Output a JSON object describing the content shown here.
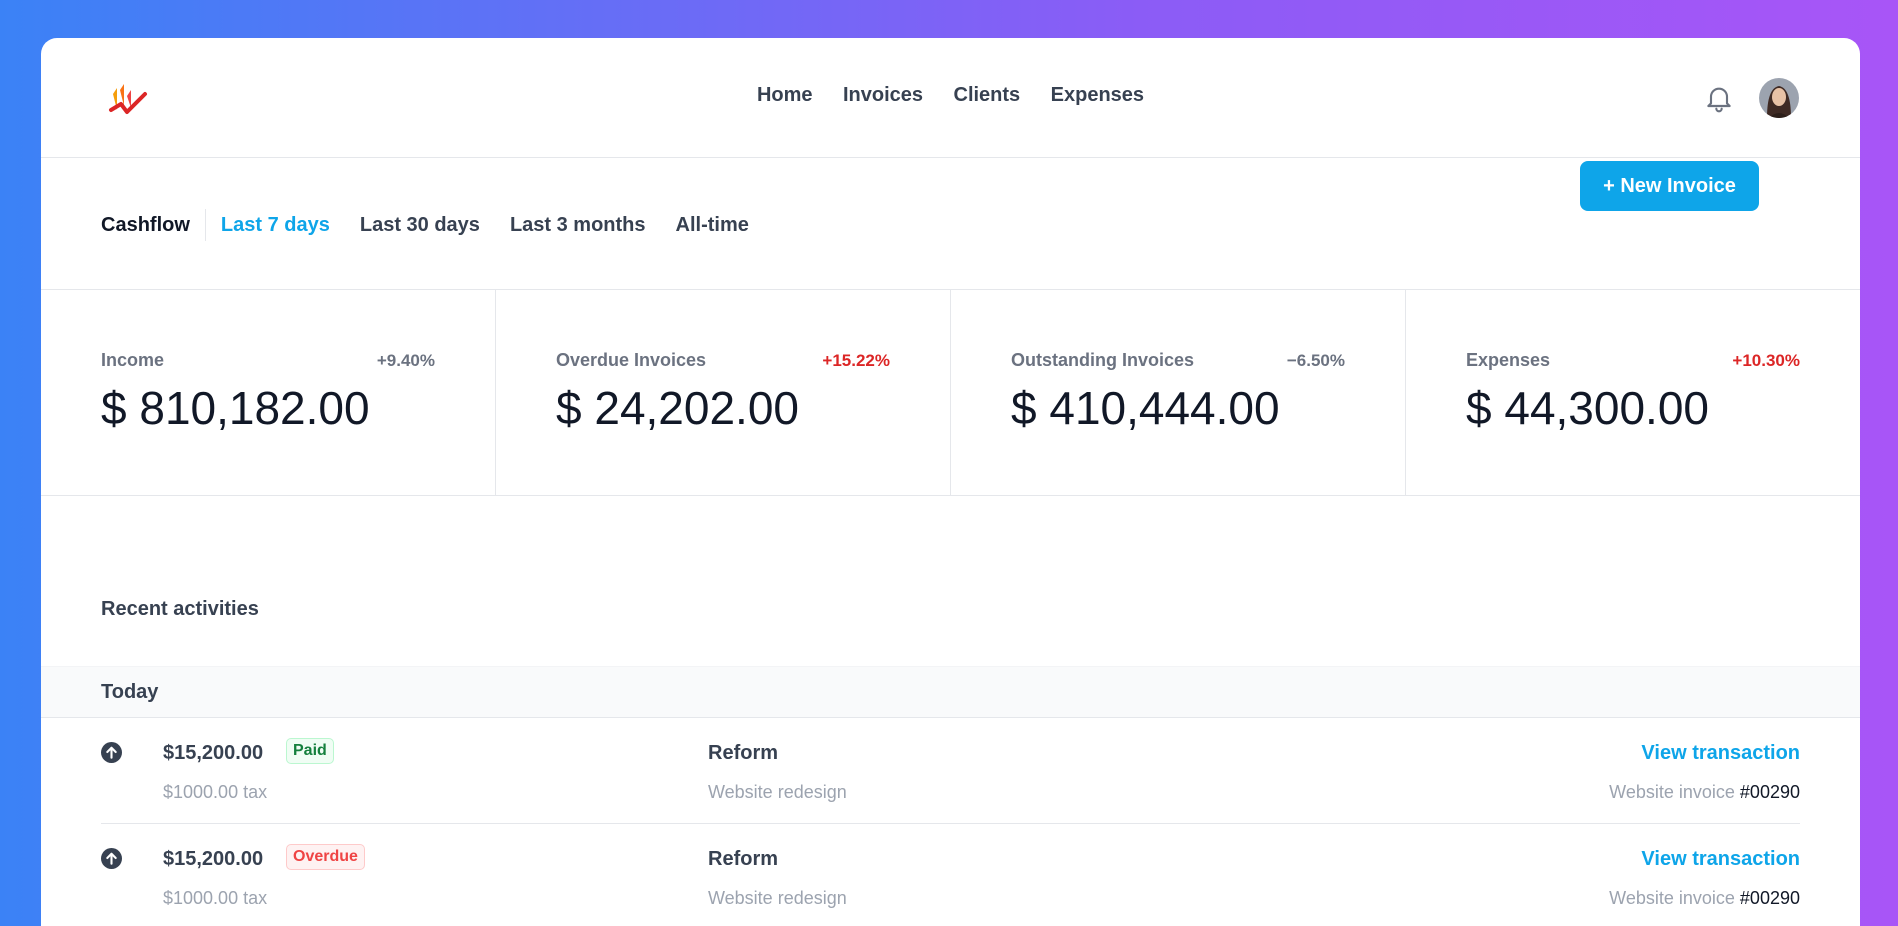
{
  "colors": {
    "accent": "#0ea5e9",
    "negative": "#dc2626",
    "paid": "#15803d",
    "overdue": "#ef4444",
    "logo_red": "#dc2626",
    "logo_orange": "#f59e0b"
  },
  "header": {
    "logo_icon": "chart-logo-icon",
    "nav": [
      {
        "label": "Home"
      },
      {
        "label": "Invoices"
      },
      {
        "label": "Clients"
      },
      {
        "label": "Expenses"
      }
    ],
    "notification_icon": "bell-icon",
    "avatar_icon": "user-avatar"
  },
  "toolbar": {
    "section_label": "Cashflow",
    "filters": [
      {
        "label": "Last 7 days",
        "active": true
      },
      {
        "label": "Last 30 days",
        "active": false
      },
      {
        "label": "Last 3 months",
        "active": false
      },
      {
        "label": "All-time",
        "active": false
      }
    ],
    "new_invoice_label": "+ New Invoice"
  },
  "stats": [
    {
      "label": "Income",
      "change": "+9.40%",
      "value": "$ 810,182.00",
      "change_negative": false
    },
    {
      "label": "Overdue Invoices",
      "change": "+15.22%",
      "value": "$ 24,202.00",
      "change_negative": true
    },
    {
      "label": "Outstanding Invoices",
      "change": "−6.50%",
      "value": "$ 410,444.00",
      "change_negative": false
    },
    {
      "label": "Expenses",
      "change": "+10.30%",
      "value": "$ 44,300.00",
      "change_negative": true
    }
  ],
  "activities": {
    "title": "Recent activities",
    "day": "Today",
    "rows": [
      {
        "icon": "arrow-up-circle-icon",
        "amount": "$15,200.00",
        "status": "Paid",
        "tax": "$1000.00 tax",
        "client": "Reform",
        "project": "Website redesign",
        "link": "View transaction",
        "invoice_label": "Website invoice",
        "invoice_number": "#00290"
      },
      {
        "icon": "arrow-up-circle-icon",
        "amount": "$15,200.00",
        "status": "Overdue",
        "tax": "$1000.00 tax",
        "client": "Reform",
        "project": "Website redesign",
        "link": "View transaction",
        "invoice_label": "Website invoice",
        "invoice_number": "#00290"
      }
    ]
  }
}
